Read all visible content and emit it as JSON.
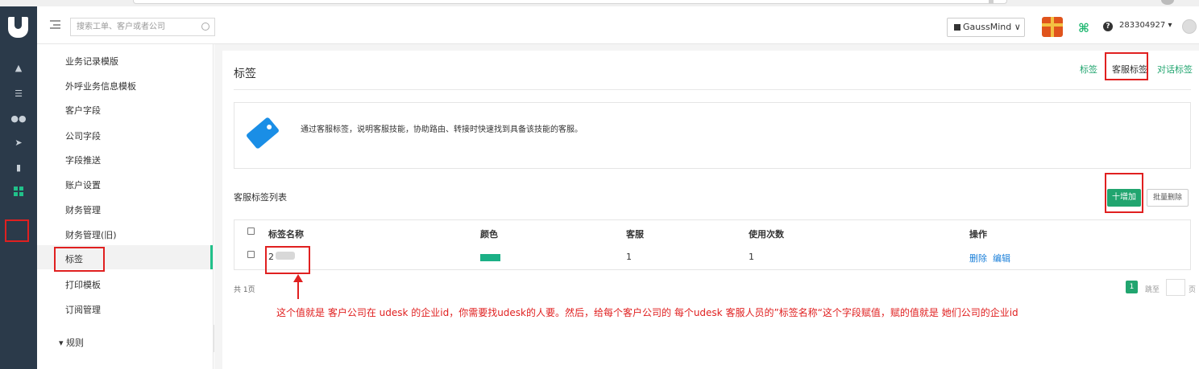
{
  "app": {
    "brand": "udesk",
    "accent": "#21a56f",
    "annotation_color": "#e02020"
  },
  "topbar": {
    "search_placeholder": "搜索工单、客户或者公司",
    "workspace": "GaussMind",
    "user": "283304927 ▾"
  },
  "nav_icons": [
    "home-icon",
    "list-icon",
    "users-icon",
    "send-icon",
    "book-icon",
    "apps-grid-icon"
  ],
  "sidemenu": {
    "items": [
      "业务记录模版",
      "外呼业务信息模板",
      "客户字段",
      "公司字段",
      "字段推送",
      "账户设置",
      "财务管理",
      "财务管理(旧)",
      "标签",
      "打印模板",
      "订阅管理",
      "▾ 规则"
    ],
    "active": "标签"
  },
  "page": {
    "title": "标签",
    "tabs": [
      "标签",
      "客服标签",
      "对话标签"
    ],
    "active_tab": "客服标签",
    "info": "通过客服标签，说明客服技能，协助路由、转接时快速找到具备该技能的客服。",
    "list_title": "客服标签列表",
    "add_button": "十增加",
    "batch_delete_button": "批量删除"
  },
  "table": {
    "columns": [
      "标签名称",
      "颜色",
      "客服",
      "使用次数",
      "操作"
    ],
    "rows": [
      {
        "name": "2",
        "color": "#1bb086",
        "agents": "1",
        "usage": "1",
        "actions": [
          "删除",
          "编辑"
        ]
      }
    ]
  },
  "pagination": {
    "total": "共 1页",
    "current": "1",
    "jump_label": "跳至",
    "page_label": "页"
  },
  "annotation": "这个值就是  客户公司在 udesk 的企业id，你需要找udesk的人要。然后，给每个客户公司的 每个udesk 客服人员的”标签名称“这个字段赋值，赋的值就是 她们公司的企业id"
}
